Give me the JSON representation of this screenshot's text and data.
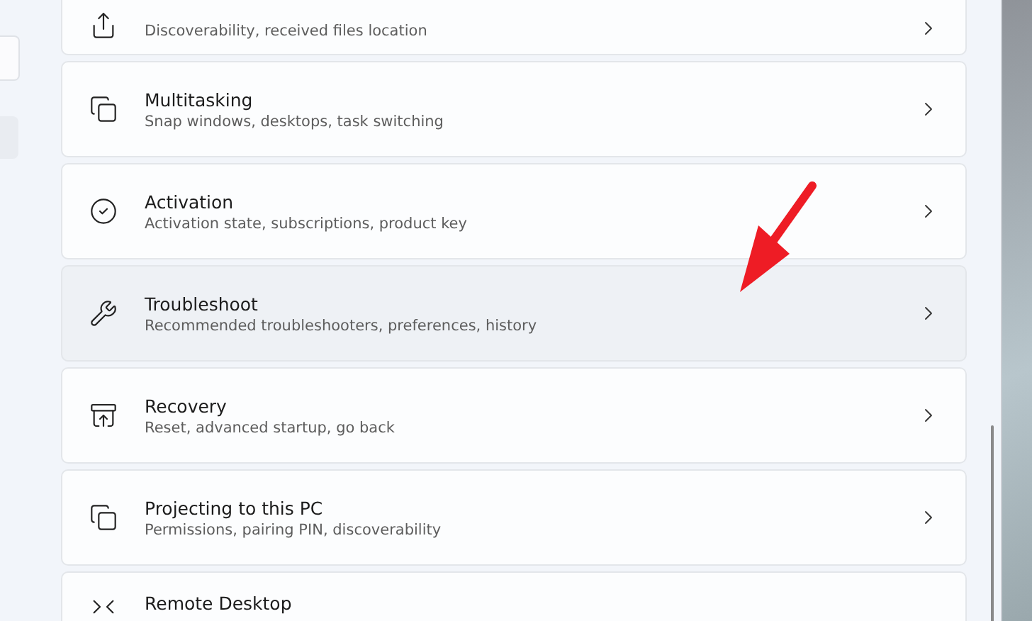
{
  "items": [
    {
      "subtitle": "Discoverability, received files location",
      "hovered": false
    },
    {
      "title": "Multitasking",
      "subtitle": "Snap windows, desktops, task switching",
      "hovered": false
    },
    {
      "title": "Activation",
      "subtitle": "Activation state, subscriptions, product key",
      "hovered": false
    },
    {
      "title": "Troubleshoot",
      "subtitle": "Recommended troubleshooters, preferences, history",
      "hovered": true
    },
    {
      "title": "Recovery",
      "subtitle": "Reset, advanced startup, go back",
      "hovered": false
    },
    {
      "title": "Projecting to this PC",
      "subtitle": "Permissions, pairing PIN, discoverability",
      "hovered": false
    },
    {
      "title": "Remote Desktop",
      "hovered": false
    }
  ]
}
